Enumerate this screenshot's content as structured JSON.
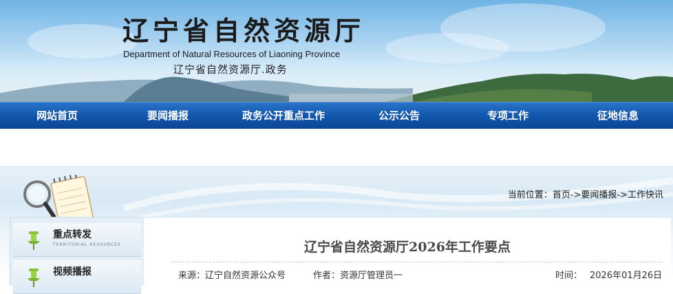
{
  "header": {
    "title_cn": "辽宁省自然资源厅",
    "title_en": "Department of Natural Resources of Liaoning Province",
    "subtitle": "辽宁省自然资源厅.政务"
  },
  "nav": {
    "items": [
      {
        "label": "网站首页"
      },
      {
        "label": "要闻播报"
      },
      {
        "label": "政务公开重点工作"
      },
      {
        "label": "公示公告"
      },
      {
        "label": "专项工作"
      },
      {
        "label": "征地信息"
      }
    ]
  },
  "breadcrumb": "当前位置：首页->要闻播报->工作快讯",
  "sidebar": {
    "items": [
      {
        "title": "重点转发",
        "subtitle": "TERRITORIAL RESOURCES"
      },
      {
        "title": "视频播报",
        "subtitle": ""
      }
    ]
  },
  "article": {
    "title": "辽宁省自然资源厅2026年工作要点",
    "source": "来源：辽宁自然资源公众号",
    "author": "作者：资源厅管理员一",
    "time_label": "时间：",
    "time_value": "2026年01月26日"
  },
  "colors": {
    "nav": "#1257ad",
    "sky": "#a9d3f1",
    "pin": "#8ac43a"
  },
  "icons": [
    "magnifier-notepad-icon",
    "pin-icon"
  ]
}
